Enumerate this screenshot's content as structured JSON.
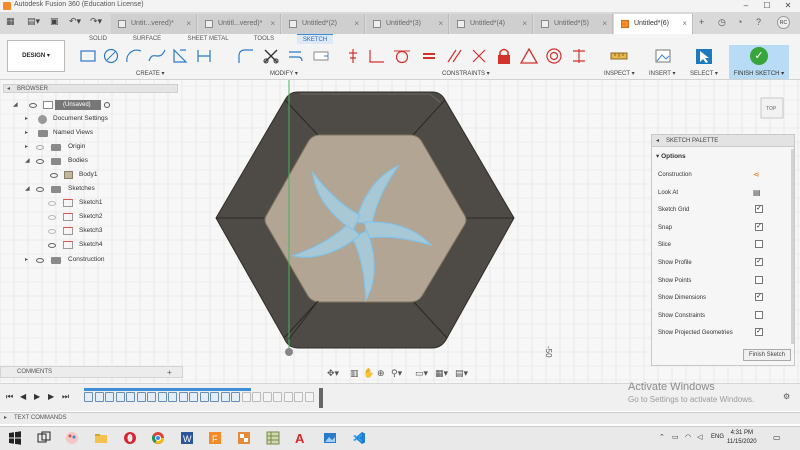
{
  "window": {
    "title": "Autodesk Fusion 360 (Education License)"
  },
  "tabs": [
    {
      "label": "Untit...vered)*",
      "active": false
    },
    {
      "label": "Untitl...vered)*",
      "active": false
    },
    {
      "label": "Untitled*(2)",
      "active": false
    },
    {
      "label": "Untitled*(3)",
      "active": false
    },
    {
      "label": "Untitled*(4)",
      "active": false
    },
    {
      "label": "Untitled*(5)",
      "active": false
    },
    {
      "label": "Untitled*(6)",
      "active": true
    }
  ],
  "user": {
    "initials": "RC"
  },
  "toolbar": {
    "workspace": "DESIGN ▾",
    "tabs": [
      "SOLID",
      "SURFACE",
      "SHEET METAL",
      "TOOLS",
      "SKETCH"
    ],
    "groups": [
      "CREATE ▾",
      "MODIFY ▾",
      "CONSTRAINTS ▾",
      "INSPECT ▾",
      "INSERT ▾",
      "SELECT ▾"
    ],
    "finish_sketch": "FINISH SKETCH ▾"
  },
  "browser": {
    "title": "BROWSER",
    "root": "(Unsaved)",
    "items": [
      {
        "label": "Document Settings"
      },
      {
        "label": "Named Views"
      },
      {
        "label": "Origin"
      },
      {
        "label": "Bodies"
      },
      {
        "label": "Body1"
      },
      {
        "label": "Sketches"
      },
      {
        "label": "Sketch1"
      },
      {
        "label": "Sketch2"
      },
      {
        "label": "Sketch3"
      },
      {
        "label": "Sketch4"
      },
      {
        "label": "Construction"
      }
    ]
  },
  "viewcube": {
    "label": "TOP"
  },
  "dimension_label": "-50",
  "palette": {
    "title": "SKETCH PALETTE",
    "section": "Options",
    "options": [
      {
        "label": "Construction",
        "control": "icon",
        "checked": false
      },
      {
        "label": "Look At",
        "control": "icon",
        "checked": false
      },
      {
        "label": "Sketch Grid",
        "control": "check",
        "checked": true
      },
      {
        "label": "Snap",
        "control": "check",
        "checked": true
      },
      {
        "label": "Slice",
        "control": "check",
        "checked": false
      },
      {
        "label": "Show Profile",
        "control": "check",
        "checked": true
      },
      {
        "label": "Show Points",
        "control": "check",
        "checked": false
      },
      {
        "label": "Show Dimensions",
        "control": "check",
        "checked": true
      },
      {
        "label": "Show Constraints",
        "control": "check",
        "checked": false
      },
      {
        "label": "Show Projected Geometries",
        "control": "check",
        "checked": true
      }
    ],
    "finish_button": "Finish Sketch"
  },
  "comments": {
    "label": "COMMENTS"
  },
  "text_commands": {
    "label": "TEXT COMMANDS"
  },
  "activation": {
    "title": "Activate Windows",
    "subtitle": "Go to Settings to activate Windows."
  },
  "clock": {
    "time": "4:31 PM",
    "date": "11/15/2020"
  },
  "language": "ENG",
  "colors": {
    "accent": "#3d8dd6",
    "finish": "#37a53a",
    "body_dark": "#4e4b46",
    "face": "#b3a593",
    "sketch": "#7ec4ec"
  }
}
